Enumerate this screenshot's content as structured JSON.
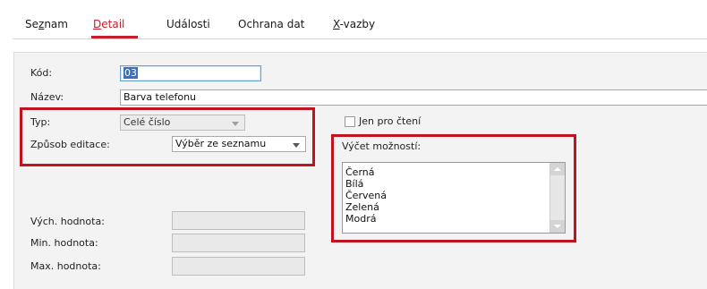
{
  "tabs": [
    {
      "pre": "Se",
      "u": "z",
      "post": "nam",
      "active": false
    },
    {
      "pre": "",
      "u": "D",
      "post": "etail",
      "active": true
    },
    {
      "pre": "",
      "u": "",
      "post": "Události",
      "active": false
    },
    {
      "pre": "",
      "u": "",
      "post": "Ochrana dat",
      "active": false
    },
    {
      "pre": "",
      "u": "X",
      "post": "-vazby",
      "active": false
    }
  ],
  "form": {
    "kod_label": "Kód:",
    "kod_value": "03",
    "nazev_label": "Název:",
    "nazev_value": "Barva telefonu",
    "typ_label": "Typ:",
    "typ_value": "Celé číslo",
    "zpusob_label": "Způsob editace:",
    "zpusob_value": "Výběr ze seznamu",
    "jen_pro_cteni_label": "Jen pro čtení",
    "vycet_label": "Výčet možností:",
    "vycet_items": [
      "Černá",
      "Bílá",
      "Červená",
      "Zelená",
      "Modrá"
    ],
    "vych_label": "Vých. hodnota:",
    "min_label": "Min. hodnota:",
    "max_label": "Max. hodnota:"
  },
  "colors": {
    "accent": "#c81d2a",
    "highlight_frame": "#c1121f",
    "selection": "#3a6fc4"
  }
}
